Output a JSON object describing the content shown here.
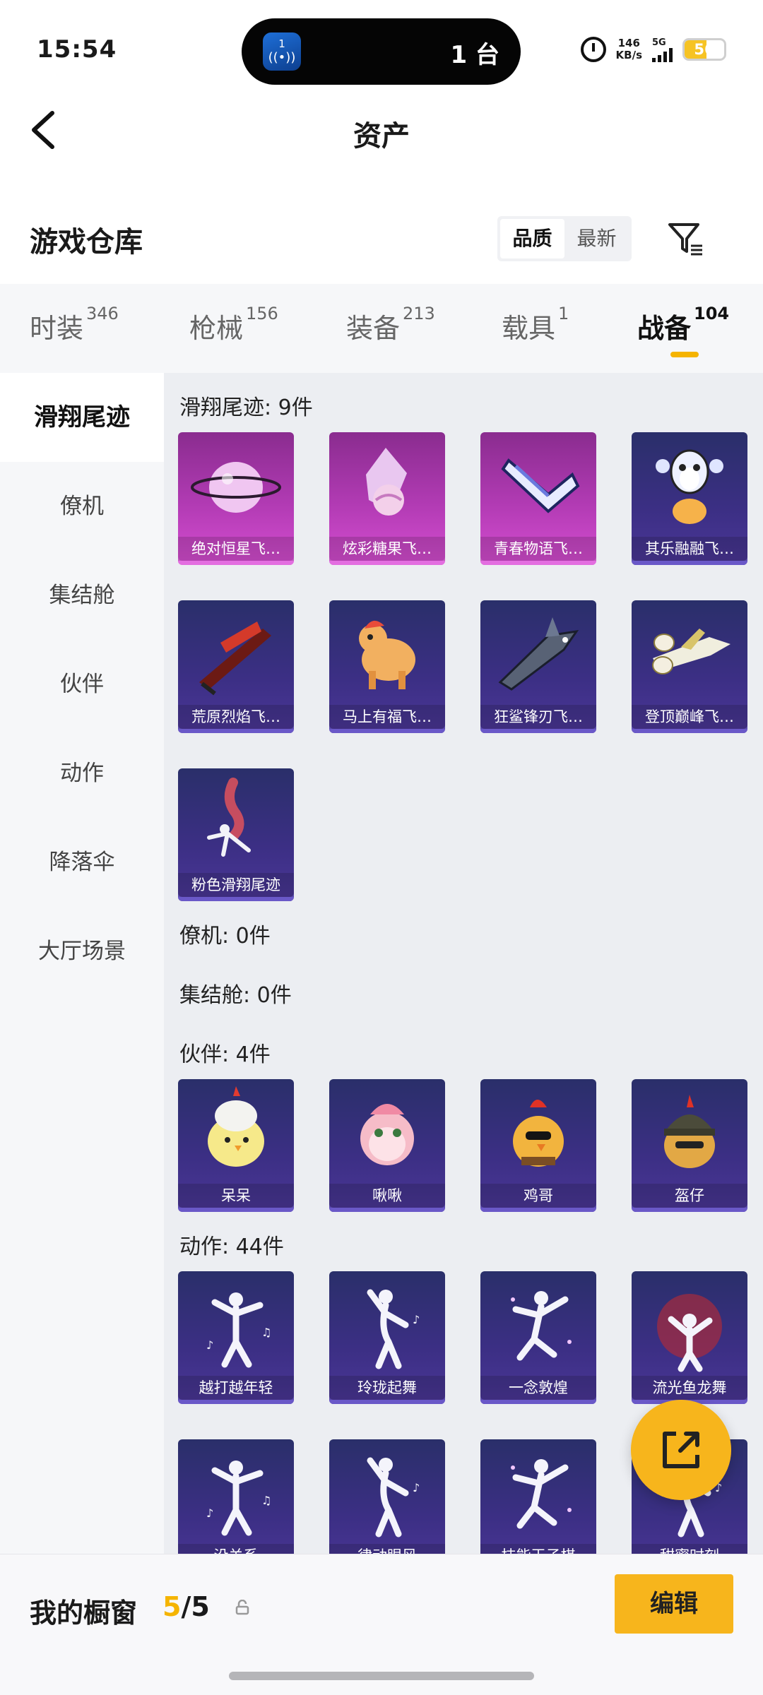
{
  "status": {
    "time": "15:54",
    "island_count": "1 台",
    "net_speed": "146",
    "net_unit": "KB/s",
    "network": "5G",
    "battery": "56",
    "battery_level": 0.56
  },
  "header": {
    "title": "资产"
  },
  "section": {
    "title": "游戏仓库",
    "sort_quality": "品质",
    "sort_newest": "最新"
  },
  "tabs": [
    {
      "label": "时装",
      "count": "346"
    },
    {
      "label": "枪械",
      "count": "156"
    },
    {
      "label": "装备",
      "count": "213"
    },
    {
      "label": "载具",
      "count": "1"
    },
    {
      "label": "战备",
      "count": "104"
    }
  ],
  "sidebar": [
    "滑翔尾迹",
    "僚机",
    "集结舱",
    "伙伴",
    "动作",
    "降落伞",
    "大厅场景"
  ],
  "groups": {
    "glide": {
      "title": "滑翔尾迹: 9件",
      "items": [
        "绝对恒星飞…",
        "炫彩糖果飞…",
        "青春物语飞…",
        "其乐融融飞…",
        "荒原烈焰飞…",
        "马上有福飞…",
        "狂鲨锋刃飞…",
        "登顶巅峰飞…",
        "粉色滑翔尾迹"
      ]
    },
    "wingman": {
      "title": "僚机: 0件"
    },
    "capsule": {
      "title": "集结舱: 0件"
    },
    "partner": {
      "title": "伙伴: 4件",
      "items": [
        "呆呆",
        "啾啾",
        "鸡哥",
        "盔仔"
      ]
    },
    "emote": {
      "title": "动作: 44件",
      "items": [
        "越打越年轻",
        "玲珑起舞",
        "一念敦煌",
        "流光鱼龙舞",
        "没关系",
        "律动眼风",
        "技能王子棋",
        "甜蜜时刻"
      ]
    }
  },
  "bottom": {
    "showcase": "我的橱窗",
    "count_current": "5",
    "count_total": "/5",
    "edit": "编辑"
  }
}
